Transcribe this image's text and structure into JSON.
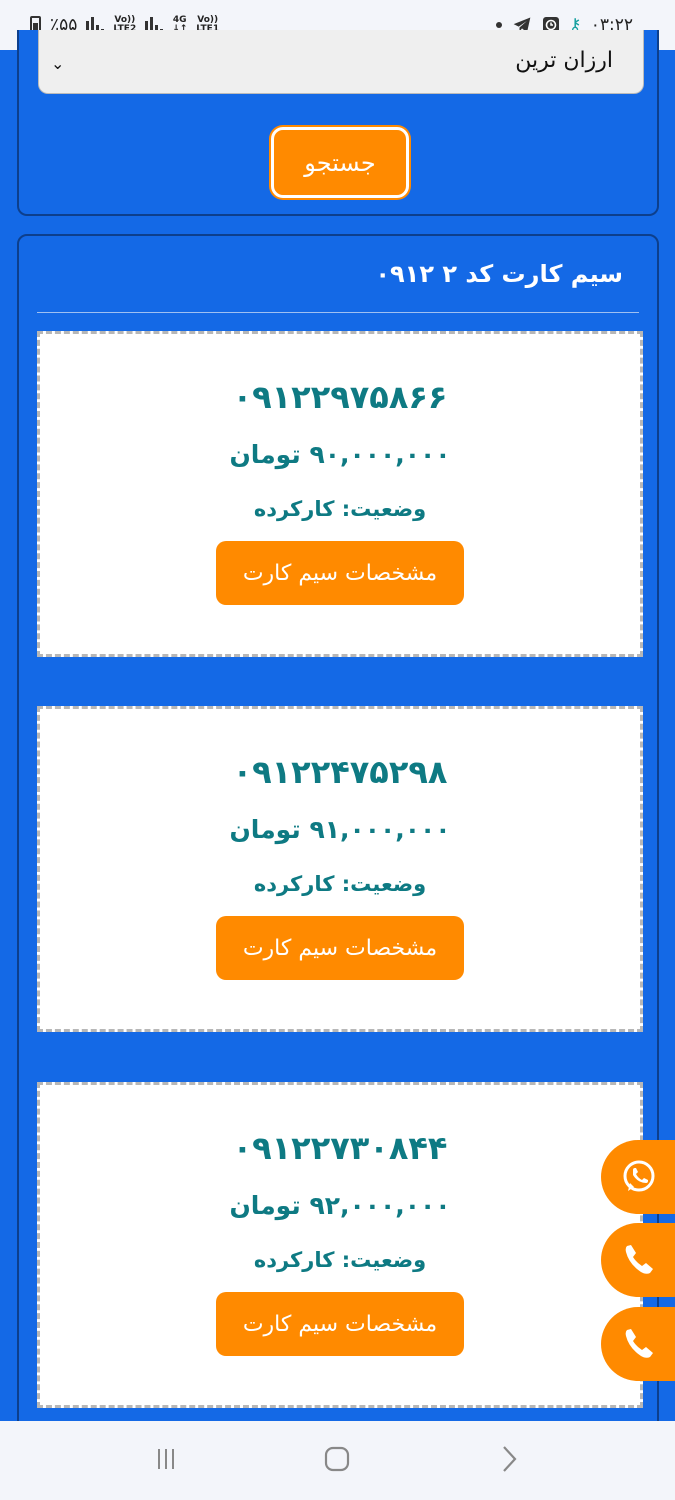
{
  "status_bar": {
    "battery": "٪۵۵",
    "sim1": "Vo))\nLTE2",
    "net": "4G",
    "sim2": "Vo))\nLTE1",
    "time": "۰۳:۲۲"
  },
  "filter": {
    "sort_value": "ارزان ترین",
    "search_label": "جستجو"
  },
  "list": {
    "title": "سیم کارت کد ۲ ۰۹۱۲",
    "items": [
      {
        "number": "۰۹۱۲۲۹۷۵۸۶۶",
        "price": "۹۰,۰۰۰,۰۰۰ تومان",
        "status": "وضعیت: کارکرده",
        "button": "مشخصات سیم کارت"
      },
      {
        "number": "۰۹۱۲۲۴۷۵۲۹۸",
        "price": "۹۱,۰۰۰,۰۰۰ تومان",
        "status": "وضعیت: کارکرده",
        "button": "مشخصات سیم کارت"
      },
      {
        "number": "۰۹۱۲۲۷۳۰۸۴۴",
        "price": "۹۲,۰۰۰,۰۰۰ تومان",
        "status": "وضعیت: کارکرده",
        "button": "مشخصات سیم کارت"
      }
    ]
  },
  "floating_buttons": [
    "whatsapp-icon",
    "phone-icon",
    "phone-icon"
  ],
  "colors": {
    "primary": "#1469e6",
    "accent": "#ff8a00",
    "number_text": "#0e7a83"
  }
}
